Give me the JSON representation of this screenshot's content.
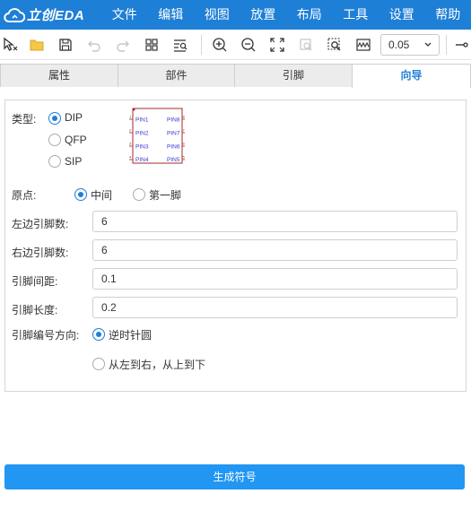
{
  "app": {
    "logo_text": "立创EDA",
    "accent": "#1e7fd6",
    "button_color": "#2196f3"
  },
  "menu": [
    "文件",
    "编辑",
    "视图",
    "放置",
    "布局",
    "工具",
    "设置",
    "帮助"
  ],
  "toolbar": {
    "icons": [
      "select-cursor-icon",
      "folder-open-icon",
      "save-icon",
      "undo-icon",
      "redo-icon",
      "grid-layout-icon",
      "search-list-icon",
      "zoom-in-icon",
      "zoom-out-icon",
      "fit-screen-icon",
      "zoom-area-icon",
      "zoom-selection-icon",
      "waveform-icon",
      "pin-icon"
    ],
    "zoom_value": "0.05"
  },
  "tabs": [
    "属性",
    "部件",
    "引脚",
    "向导"
  ],
  "active_tab": "向导",
  "wizard": {
    "type_label": "类型:",
    "types": [
      {
        "label": "DIP",
        "checked": true
      },
      {
        "label": "QFP",
        "checked": false
      },
      {
        "label": "SIP",
        "checked": false
      }
    ],
    "preview_pins_left": [
      "PIN1",
      "PIN2",
      "PIN3",
      "PIN4"
    ],
    "preview_pins_right": [
      "PIN8",
      "PIN7",
      "PIN6",
      "PIN5"
    ],
    "preview_nums_left": [
      "1",
      "2",
      "3",
      "4"
    ],
    "preview_nums_right": [
      "8",
      "7",
      "6",
      "5"
    ],
    "origin_label": "原点:",
    "origin_options": [
      {
        "label": "中间",
        "checked": true
      },
      {
        "label": "第一脚",
        "checked": false
      }
    ],
    "fields": [
      {
        "label": "左边引脚数:",
        "value": "6"
      },
      {
        "label": "右边引脚数:",
        "value": "6"
      },
      {
        "label": "引脚间距:",
        "value": "0.1"
      },
      {
        "label": "引脚长度:",
        "value": "0.2"
      }
    ],
    "direction_label": "引脚编号方向:",
    "direction_options": [
      {
        "label": "逆时针圆",
        "checked": true
      },
      {
        "label": "从左到右，从上到下",
        "checked": false
      }
    ]
  },
  "generate_button": "生成符号"
}
